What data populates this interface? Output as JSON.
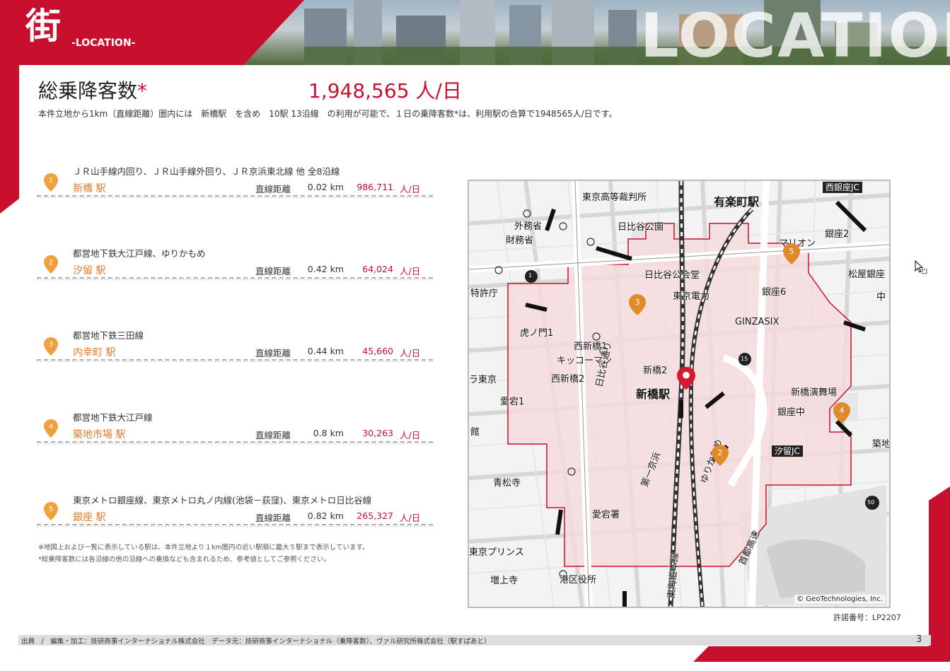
{
  "header": {
    "kanji": "街",
    "subtitle": "-LOCATION-",
    "bigword": "LOCATION"
  },
  "title": {
    "label": "総乗降客数",
    "asterisk": "*",
    "value": "1,948,565 人/日",
    "intro": "本件立地から1km（直線距離）圏内には　新橋駅　を含め　10駅 13沿線　の利用が可能で、１日の乗降客数*は、利用駅の合算で1948565人/日です。"
  },
  "stations": [
    {
      "num": "1",
      "lines": "ＪＲ山手線内回り、ＪＲ山手線外回り、ＪＲ京浜東北線 他 全8沿線",
      "name": "新橋 駅",
      "distance_label": "直線距離",
      "distance": "0.02 km",
      "passengers": "986,711",
      "unit": "人/日"
    },
    {
      "num": "2",
      "lines": "都営地下鉄大江戸線、ゆりかもめ",
      "name": "汐留 駅",
      "distance_label": "直線距離",
      "distance": "0.42 km",
      "passengers": "64,024",
      "unit": "人/日"
    },
    {
      "num": "3",
      "lines": "都営地下鉄三田線",
      "name": "内幸町 駅",
      "distance_label": "直線距離",
      "distance": "0.44 km",
      "passengers": "45,660",
      "unit": "人/日"
    },
    {
      "num": "4",
      "lines": "都営地下鉄大江戸線",
      "name": "築地市場 駅",
      "distance_label": "直線距離",
      "distance": "0.8 km",
      "passengers": "30,263",
      "unit": "人/日"
    },
    {
      "num": "5",
      "lines": "東京メトロ銀座線、東京メトロ丸ノ内線(池袋－荻窪)、東京メトロ日比谷線",
      "name": "銀座 駅",
      "distance_label": "直線距離",
      "distance": "0.82 km",
      "passengers": "265,327",
      "unit": "人/日"
    }
  ],
  "notes": [
    "※地図上および一覧に表示している駅は、本件立地より１km圏内の近い駅順に最大５駅まで表示しています。",
    "*総乗降客数には各沿線の他の沿線への乗換なども含まれるため、参考値としてご参照ください。"
  ],
  "map": {
    "labels": {
      "court": "東京高等裁判所",
      "yurakucho": "有楽町駅",
      "nishiginza_jc": "西銀座JC",
      "gaimusho": "外務省",
      "zaimusho": "財務省",
      "hibiya_park": "日比谷公園",
      "ginza2": "銀座2",
      "marion": "マリオン",
      "matsuya": "松屋銀座",
      "hibiya_hall": "日比谷公会堂",
      "tepco": "東京電力",
      "ginza6": "銀座6",
      "tokkyocho": "特許庁",
      "ginzasix": "GINZASIX",
      "toranomon1": "虎ノ門1",
      "nishishinbashi1": "西新橋1",
      "kikkoman": "キッコーマン",
      "shinbashi2": "新橋2",
      "nishishinbashi2": "西新橋2",
      "shinbashi_station": "新橋駅",
      "okura": "ラ東京",
      "atago1": "愛宕1",
      "hibiya_dori": "日比谷通り",
      "shinbashi_enbujo": "新橋演舞場",
      "ginza_chu": "銀座中",
      "kan": "館",
      "daiichi_keihin": "第一京浜",
      "yurikamome": "ゆりかもめ",
      "shiodome_jc": "汐留JC",
      "tsukiji": "築地",
      "seishoji": "青松寺",
      "atago_police": "愛宕署",
      "tokaido": "東海道本線",
      "shuto": "首都高速",
      "prince": "東京プリンス",
      "zojoji": "増上寺",
      "minato_office": "港区役所",
      "chu": "中",
      "route1": "1",
      "route15": "15",
      "route50": "50"
    },
    "copyright": "© GeoTechnologies, Inc.",
    "license": "許諾番号：LP2207",
    "colors": {
      "area_fill": "#f6d9db",
      "area_border": "#c8102e",
      "pin": "#e08a2c",
      "main_pin": "#d7192f"
    }
  },
  "footer": {
    "text": "出典　/　編集・加工：技研商事インターナショナル株式会社　データ元：技研商事インターナショナル（乗降客数）、ヴァル研究所株式会社（駅すぱあと）",
    "page": "3"
  }
}
